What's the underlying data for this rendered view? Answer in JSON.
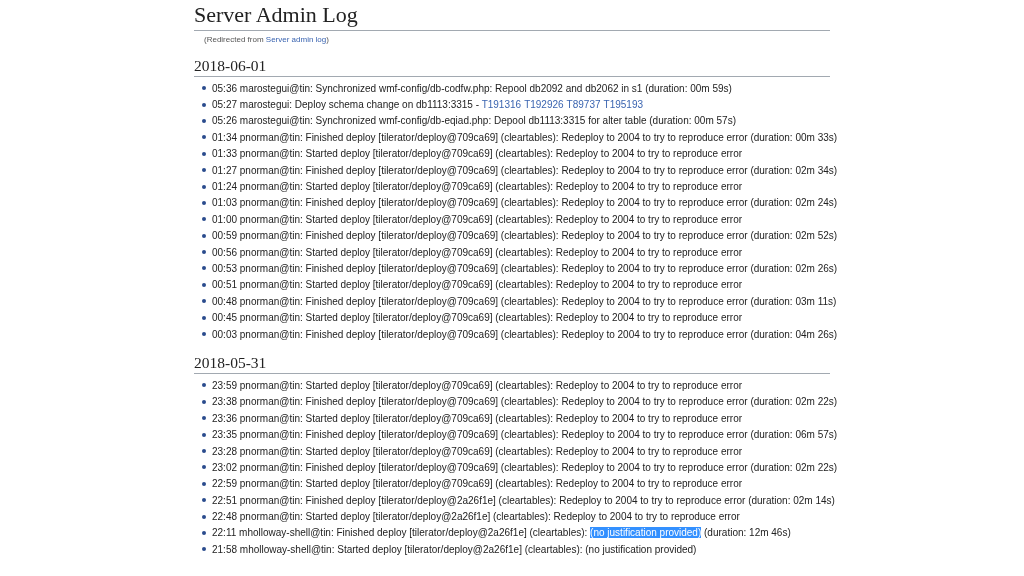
{
  "title": "Server Admin Log",
  "redirect": [
    {
      "kind": "plain",
      "text": "(Redirected from "
    },
    {
      "kind": "link",
      "text": "Server admin log"
    },
    {
      "kind": "plain",
      "text": ")"
    }
  ],
  "sections": [
    {
      "heading": "2018-06-01",
      "entries": [
        [
          {
            "kind": "plain",
            "text": "05:36 marostegui@tin: Synchronized wmf-config/db-codfw.php: Repool db2092 and db2062 in s1 (duration: 00m 59s)"
          }
        ],
        [
          {
            "kind": "plain",
            "text": "05:27 marostegui: Deploy schema change on db1113:3315 - "
          },
          {
            "kind": "link",
            "text": "T191316"
          },
          {
            "kind": "link",
            "text": "T192926"
          },
          {
            "kind": "link",
            "text": "T89737"
          },
          {
            "kind": "link",
            "text": "T195193"
          }
        ],
        [
          {
            "kind": "plain",
            "text": "05:26 marostegui@tin: Synchronized wmf-config/db-eqiad.php: Depool db1113:3315 for alter table (duration: 00m 57s)"
          }
        ],
        [
          {
            "kind": "plain",
            "text": "01:34 pnorman@tin: Finished deploy [tilerator/deploy@709ca69] (cleartables): Redeploy to 2004 to try to reproduce error (duration: 00m 33s)"
          }
        ],
        [
          {
            "kind": "plain",
            "text": "01:33 pnorman@tin: Started deploy [tilerator/deploy@709ca69] (cleartables): Redeploy to 2004 to try to reproduce error"
          }
        ],
        [
          {
            "kind": "plain",
            "text": "01:27 pnorman@tin: Finished deploy [tilerator/deploy@709ca69] (cleartables): Redeploy to 2004 to try to reproduce error (duration: 02m 34s)"
          }
        ],
        [
          {
            "kind": "plain",
            "text": "01:24 pnorman@tin: Started deploy [tilerator/deploy@709ca69] (cleartables): Redeploy to 2004 to try to reproduce error"
          }
        ],
        [
          {
            "kind": "plain",
            "text": "01:03 pnorman@tin: Finished deploy [tilerator/deploy@709ca69] (cleartables): Redeploy to 2004 to try to reproduce error (duration: 02m 24s)"
          }
        ],
        [
          {
            "kind": "plain",
            "text": "01:00 pnorman@tin: Started deploy [tilerator/deploy@709ca69] (cleartables): Redeploy to 2004 to try to reproduce error"
          }
        ],
        [
          {
            "kind": "plain",
            "text": "00:59 pnorman@tin: Finished deploy [tilerator/deploy@709ca69] (cleartables): Redeploy to 2004 to try to reproduce error (duration: 02m 52s)"
          }
        ],
        [
          {
            "kind": "plain",
            "text": "00:56 pnorman@tin: Started deploy [tilerator/deploy@709ca69] (cleartables): Redeploy to 2004 to try to reproduce error"
          }
        ],
        [
          {
            "kind": "plain",
            "text": "00:53 pnorman@tin: Finished deploy [tilerator/deploy@709ca69] (cleartables): Redeploy to 2004 to try to reproduce error (duration: 02m 26s)"
          }
        ],
        [
          {
            "kind": "plain",
            "text": "00:51 pnorman@tin: Started deploy [tilerator/deploy@709ca69] (cleartables): Redeploy to 2004 to try to reproduce error"
          }
        ],
        [
          {
            "kind": "plain",
            "text": "00:48 pnorman@tin: Finished deploy [tilerator/deploy@709ca69] (cleartables): Redeploy to 2004 to try to reproduce error (duration: 03m 11s)"
          }
        ],
        [
          {
            "kind": "plain",
            "text": "00:45 pnorman@tin: Started deploy [tilerator/deploy@709ca69] (cleartables): Redeploy to 2004 to try to reproduce error"
          }
        ],
        [
          {
            "kind": "plain",
            "text": "00:03 pnorman@tin: Finished deploy [tilerator/deploy@709ca69] (cleartables): Redeploy to 2004 to try to reproduce error (duration: 04m 26s)"
          }
        ]
      ]
    },
    {
      "heading": "2018-05-31",
      "entries": [
        [
          {
            "kind": "plain",
            "text": "23:59 pnorman@tin: Started deploy [tilerator/deploy@709ca69] (cleartables): Redeploy to 2004 to try to reproduce error"
          }
        ],
        [
          {
            "kind": "plain",
            "text": "23:38 pnorman@tin: Finished deploy [tilerator/deploy@709ca69] (cleartables): Redeploy to 2004 to try to reproduce error (duration: 02m 22s)"
          }
        ],
        [
          {
            "kind": "plain",
            "text": "23:36 pnorman@tin: Started deploy [tilerator/deploy@709ca69] (cleartables): Redeploy to 2004 to try to reproduce error"
          }
        ],
        [
          {
            "kind": "plain",
            "text": "23:35 pnorman@tin: Finished deploy [tilerator/deploy@709ca69] (cleartables): Redeploy to 2004 to try to reproduce error (duration: 06m 57s)"
          }
        ],
        [
          {
            "kind": "plain",
            "text": "23:28 pnorman@tin: Started deploy [tilerator/deploy@709ca69] (cleartables): Redeploy to 2004 to try to reproduce error"
          }
        ],
        [
          {
            "kind": "plain",
            "text": "23:02 pnorman@tin: Finished deploy [tilerator/deploy@709ca69] (cleartables): Redeploy to 2004 to try to reproduce error (duration: 02m 22s)"
          }
        ],
        [
          {
            "kind": "plain",
            "text": "22:59 pnorman@tin: Started deploy [tilerator/deploy@709ca69] (cleartables): Redeploy to 2004 to try to reproduce error"
          }
        ],
        [
          {
            "kind": "plain",
            "text": "22:51 pnorman@tin: Finished deploy [tilerator/deploy@2a26f1e] (cleartables): Redeploy to 2004 to try to reproduce error (duration: 02m 14s)"
          }
        ],
        [
          {
            "kind": "plain",
            "text": "22:48 pnorman@tin: Started deploy [tilerator/deploy@2a26f1e] (cleartables): Redeploy to 2004 to try to reproduce error"
          }
        ],
        [
          {
            "kind": "plain",
            "text": "22:11 mholloway-shell@tin: Finished deploy [tilerator/deploy@2a26f1e] (cleartables): "
          },
          {
            "kind": "selected",
            "text": "(no justification provided)"
          },
          {
            "kind": "plain",
            "text": " (duration: 12m 46s)"
          }
        ],
        [
          {
            "kind": "plain",
            "text": "21:58 mholloway-shell@tin: Started deploy [tilerator/deploy@2a26f1e] (cleartables): (no justification provided)"
          }
        ]
      ]
    }
  ]
}
